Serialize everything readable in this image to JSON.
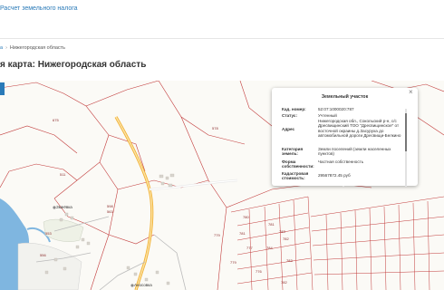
{
  "header": {
    "top_link": "Расчет земельного налога",
    "breadcrumb_link": "а",
    "breadcrumb_current": "Нижегородская область",
    "page_title": "я карта: Нижегородская область"
  },
  "map": {
    "parcel_labels": [
      "675",
      "578",
      "511",
      "598",
      "563",
      "553",
      "556",
      "780",
      "779",
      "781",
      "781",
      "783",
      "782",
      "777",
      "784",
      "776",
      "779",
      "783",
      "782"
    ],
    "place_labels": [
      "Змеёвка",
      "Аносовка"
    ]
  },
  "popup": {
    "title": "Земельный участок",
    "close": "×",
    "rows": [
      {
        "key": "Кад. номер:",
        "value": "52:07:1000020:787"
      },
      {
        "key": "Статус:",
        "value": "Учтенный"
      },
      {
        "key": "Адрес",
        "value": "Нижегородская обл., Сокольский р-н, с/с Дресвищинский ТОО \"Дресвищинское\" от восточной окраины д.Засуруха до автомобильной дороги Дресвищи-Белкино"
      },
      {
        "key": "Категория земель:",
        "value": "Земли поселений (земли населенных пунктов)"
      },
      {
        "key": "Форма собственности:",
        "value": "Частная собственность"
      },
      {
        "key": "Кадастровая стоимость:",
        "value": "29567872.45 руб"
      }
    ]
  },
  "colors": {
    "link": "#2a7ab8",
    "parcel_line": "#c23a3a",
    "road": "#f2b134",
    "water": "#7fb6e0",
    "background": "#fbfaf6"
  }
}
